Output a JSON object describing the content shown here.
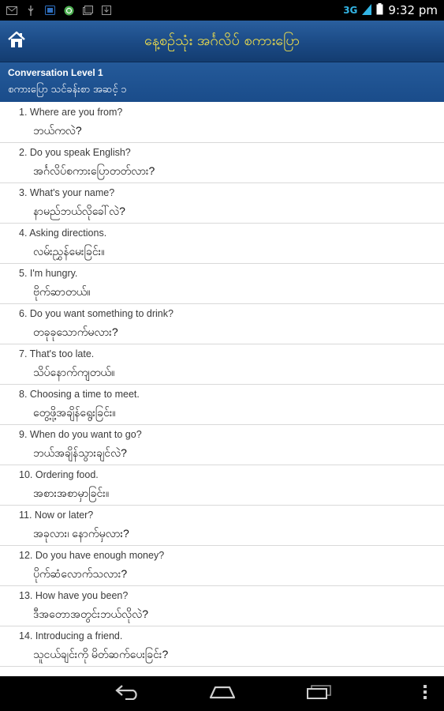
{
  "status_bar": {
    "network": "3G",
    "time": "9:32 pm",
    "icons": [
      "mail-icon",
      "usb-icon",
      "notification-icon",
      "sync-icon",
      "gallery-icon",
      "download-icon"
    ]
  },
  "app_bar": {
    "title": "နေ့စဉ်သုံး အင်္ဂလိပ် စကားပြော",
    "home_icon": "home-icon",
    "title_color": "#f5e34a",
    "bar_color": "#1b4a85"
  },
  "section": {
    "title": "Conversation Level 1",
    "subtitle": "စကားပြော သင်ခန်းစာ အဆင့် ၁"
  },
  "items": [
    {
      "en": "1. Where are you from?",
      "my": "ဘယ်ကလဲ?"
    },
    {
      "en": "2. Do you speak English?",
      "my": "အင်္ဂလိပ်စကားပြောတတ်လား?"
    },
    {
      "en": "3. What's your name?",
      "my": "နာမည်ဘယ်လိုခေါ်လဲ?"
    },
    {
      "en": "4. Asking directions.",
      "my": "လမ်းညွှန်မေးခြင်း။"
    },
    {
      "en": "5. I'm hungry.",
      "my": "ဗိုက်ဆာတယ်။"
    },
    {
      "en": "6. Do you want something to drink?",
      "my": "တခုခုသောက်မလား?"
    },
    {
      "en": "7. That's too late.",
      "my": "သိပ်နောက်ကျတယ်။"
    },
    {
      "en": "8. Choosing a time to meet.",
      "my": "တွေ့ဖို့အချိန်ရွေးခြင်း။"
    },
    {
      "en": "9. When do you want to go?",
      "my": "ဘယ်အချိန်သွားချင်လဲ?"
    },
    {
      "en": "10. Ordering food.",
      "my": "အစားအစာမှာခြင်း။"
    },
    {
      "en": "11. Now or later?",
      "my": "အခုလား၊ နောက်မှလား?"
    },
    {
      "en": "12. Do you have enough money?",
      "my": "ပိုက်ဆံလောက်သလား?"
    },
    {
      "en": "13. How have you been?",
      "my": "ဒီအတောအတွင်းဘယ်လိုလဲ?"
    },
    {
      "en": "14. Introducing a friend.",
      "my": "သူငယ်ချင်းကို မိတ်ဆက်ပေးခြင်း?"
    }
  ],
  "nav_bar": {
    "icons": [
      "back-icon",
      "home-nav-icon",
      "recent-apps-icon",
      "overflow-menu-icon"
    ]
  }
}
